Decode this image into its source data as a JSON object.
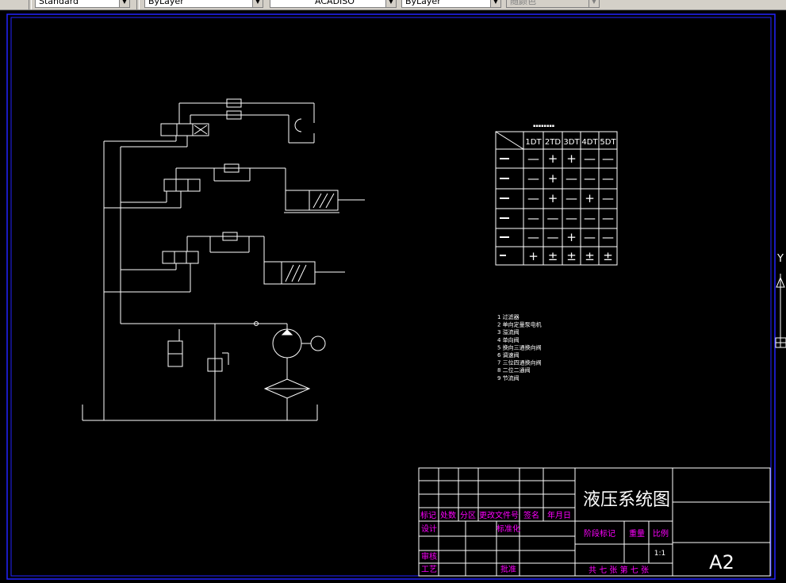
{
  "toolbar": {
    "text_style": "Standard",
    "layer_color": "ByLayer",
    "linetype": "ACADISO",
    "lineweight": "ByLayer",
    "plot_style": "随颜色"
  },
  "title_block": {
    "drawing_title": "液压系统图",
    "sheet_size": "A2",
    "scale": "1:1",
    "headers": {
      "mark": "标记",
      "count": "处数",
      "zone": "分区",
      "change_doc": "更改文件号",
      "signature": "签名",
      "date": "年月日"
    },
    "design": "设计",
    "standardize": "标准化",
    "review": "审核",
    "process": "工艺",
    "approve": "批准",
    "stage_mark": "阶段标记",
    "weight": "重量",
    "ratio": "比例",
    "sheets": "共 七  张 第 七 张"
  },
  "action_table": {
    "columns": [
      "1DT",
      "2TD",
      "3DT",
      "4DT",
      "5DT"
    ],
    "rows": [
      [
        "—",
        "+",
        "+",
        "—",
        "—"
      ],
      [
        "—",
        "+",
        "—",
        "—",
        "—"
      ],
      [
        "—",
        "+",
        "—",
        "+",
        "—"
      ],
      [
        "—",
        "—",
        "—",
        "—",
        "—"
      ],
      [
        "—",
        "—",
        "+",
        "—",
        "—"
      ],
      [
        "+",
        "±",
        "±",
        "±",
        "±"
      ]
    ]
  },
  "parts_list": [
    "1 过滤器",
    "2 单向定量泵电机",
    "3 溢流阀",
    "4 单向阀",
    "5 换向三通换向阀",
    "6 调速阀",
    "7 三位四通换向阀",
    "8 二位二通阀",
    "9 节流阀"
  ],
  "labels": {
    "ucs": "Y"
  }
}
